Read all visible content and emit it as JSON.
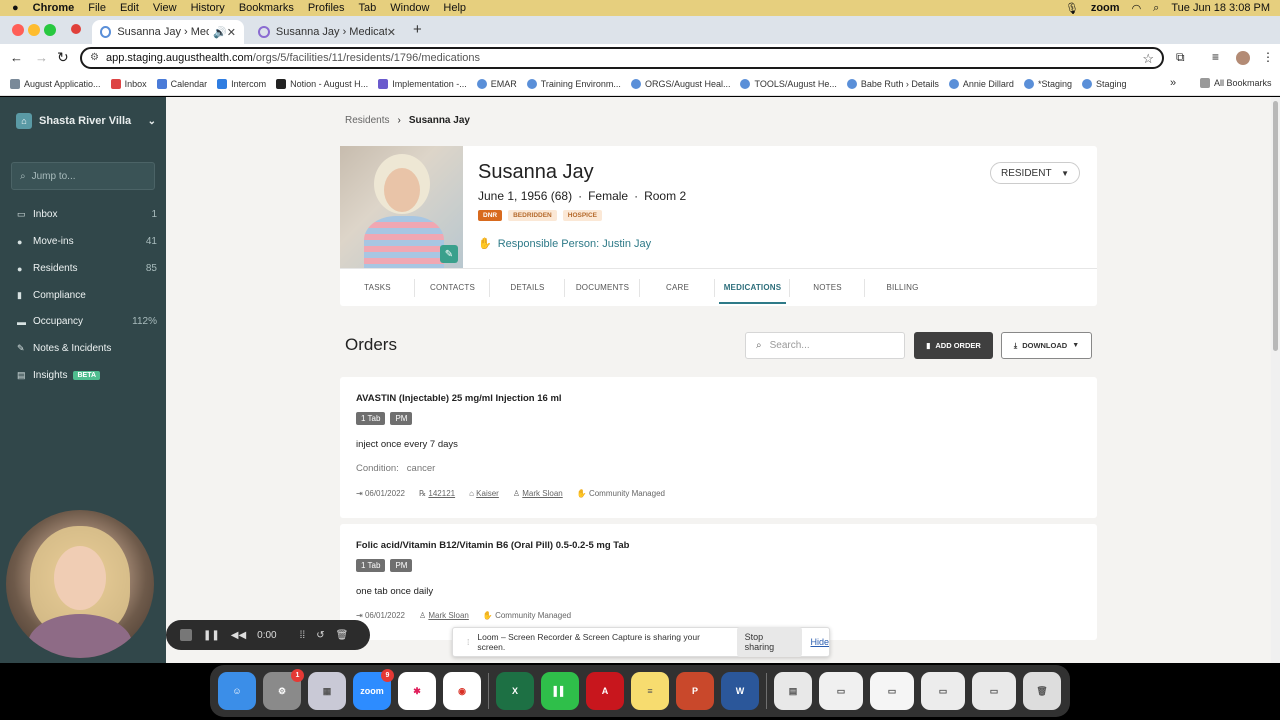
{
  "menubar": {
    "apple": "",
    "items": [
      "Chrome",
      "File",
      "Edit",
      "View",
      "History",
      "Bookmarks",
      "Profiles",
      "Tab",
      "Window",
      "Help"
    ],
    "zoom": "zoom",
    "datetime": "Tue Jun 18  3:08 PM"
  },
  "browser": {
    "tabs": [
      {
        "title": "Susanna Jay › Medicatio"
      },
      {
        "title": "Susanna Jay › Medications ·"
      }
    ],
    "url_host": "app.staging.augusthealth.com",
    "url_path": "/orgs/5/facilities/11/residents/1796/medications",
    "bookmarks": [
      "August Applicatio...",
      "Inbox",
      "Calendar",
      "Intercom",
      "Notion - August H...",
      "Implementation -...",
      "EMAR",
      "Training Environm...",
      "ORGS/August Heal...",
      "TOOLS/August He...",
      "Babe Ruth › Details",
      "Annie Dillard",
      "*Staging",
      "Staging"
    ],
    "all_bookmarks": "All Bookmarks"
  },
  "sidebar": {
    "facility": "Shasta River Villa",
    "jump_placeholder": "Jump to...",
    "items": [
      {
        "label": "Inbox",
        "count": "1",
        "icon": "inbox-icon"
      },
      {
        "label": "Move-ins",
        "count": "41",
        "icon": "people-icon"
      },
      {
        "label": "Residents",
        "count": "85",
        "icon": "residents-icon"
      },
      {
        "label": "Compliance",
        "count": "",
        "icon": "clipboard-icon"
      },
      {
        "label": "Occupancy",
        "count": "112%",
        "icon": "bed-icon"
      },
      {
        "label": "Notes & Incidents",
        "count": "",
        "icon": "notes-icon"
      },
      {
        "label": "Insights",
        "count": "",
        "icon": "chart-icon"
      }
    ],
    "beta": "BETA"
  },
  "breadcrumb": {
    "parent": "Residents",
    "sep": "›",
    "current": "Susanna Jay"
  },
  "resident": {
    "name": "Susanna Jay",
    "dob": "June 1, 1956 (68)",
    "gender": "Female",
    "room": "Room 2",
    "dot": "·",
    "tags": [
      "DNR",
      "BEDRIDDEN",
      "HOSPICE"
    ],
    "responsible": "Responsible Person: Justin Jay",
    "role_button": "RESIDENT"
  },
  "tabs": [
    "TASKS",
    "CONTACTS",
    "DETAILS",
    "DOCUMENTS",
    "CARE",
    "MEDICATIONS",
    "NOTES",
    "BILLING"
  ],
  "orders": {
    "title": "Orders",
    "search_placeholder": "Search...",
    "add_order": "ADD ORDER",
    "download": "DOWNLOAD",
    "list": [
      {
        "name": "AVASTIN (Injectable) 25 mg/ml Injection 16 ml",
        "badges": [
          "1 Tab",
          "PM"
        ],
        "instructions": "inject once every 7 days",
        "condition_label": "Condition:",
        "condition": "cancer",
        "date": "06/01/2022",
        "rx": "142121",
        "pharmacy": "Kaiser",
        "prescriber": "Mark Sloan",
        "managed": "Community Managed"
      },
      {
        "name": "Folic acid/Vitamin B12/Vitamin B6 (Oral Pill) 0.5-0.2-5 mg Tab",
        "badges": [
          "1 Tab",
          "PM"
        ],
        "instructions": "one tab once daily",
        "date": "06/01/2022",
        "prescriber": "Mark Sloan",
        "managed": "Community Managed"
      }
    ]
  },
  "recorder": {
    "time": "0:00"
  },
  "loom": {
    "message": "Loom – Screen Recorder & Screen Capture is sharing your screen.",
    "stop": "Stop sharing",
    "hide": "Hide"
  },
  "dock": {
    "apps": [
      "Finder",
      "System Settings",
      "Launchpad",
      "Zoom",
      "Slack",
      "Chrome",
      "Excel",
      "Numbers",
      "Acrobat",
      "Notes",
      "PowerPoint",
      "Word",
      "Preview",
      "Trash"
    ],
    "settings_badge": "1",
    "zoom_badge": "9",
    "zoom_label": "zoom"
  }
}
